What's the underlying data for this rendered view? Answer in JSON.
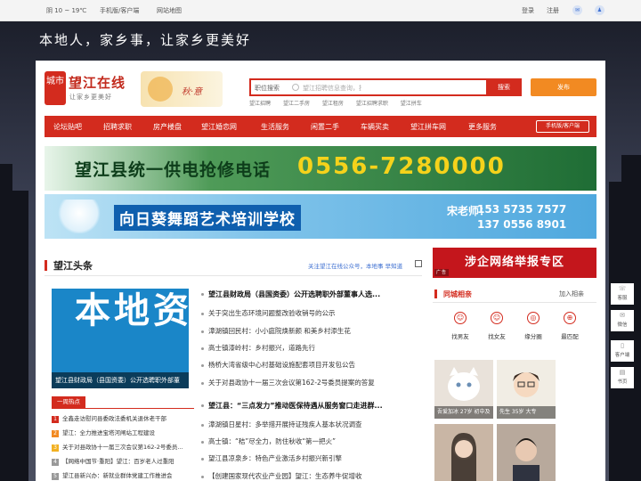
{
  "topbar": {
    "weather": "阴 10 ~ 19℃",
    "mobile": "手机版/客户端",
    "sitemap": "网站地图",
    "login": "登录",
    "register": "注册"
  },
  "slogan": "本地人，家乡事，让家乡更美好",
  "logo": {
    "seal": "城市",
    "name": "望江在线",
    "sub": "让家乡更美好"
  },
  "autumn_text": "秋·意",
  "search": {
    "category": "职位搜索",
    "placeholder": "望江招聘信息查询，找工作，就上望江在线",
    "button": "搜索"
  },
  "post_button": "发布",
  "hot_keywords": [
    "望江招聘",
    "望江二手房",
    "望江租房",
    "望江招聘求职",
    "望江拼车"
  ],
  "nav": {
    "items": [
      "论坛贴吧",
      "招聘求职",
      "房产楼盘",
      "望江婚恋网",
      "生活服务",
      "闲置二手",
      "车辆买卖",
      "望江拼车网",
      "更多服务"
    ],
    "mobile": "手机版/客户端"
  },
  "banner1": {
    "title": "望江县统一供电抢修电话",
    "phone": "0556-7280000"
  },
  "banner2": {
    "title": "向日葵舞蹈艺术培训学校",
    "contact": "宋老师：",
    "phone1": "153 5735 7577",
    "phone2": "137 0556 8901"
  },
  "section": {
    "title": "望江头条",
    "follow": "关注望江在线公众号，本地事 早知道"
  },
  "featured": {
    "big_text": "本地资讯",
    "caption": "望江县财政局（县国资委）公开选聘职外部董"
  },
  "hot_list": {
    "title": "一周热点",
    "items": [
      {
        "n": "1",
        "color": "#d32b1e",
        "text": "全鑫走访慰问县委政法委机关退休老干部"
      },
      {
        "n": "2",
        "color": "#f28a22",
        "text": "望江：全力推进宝塔河闸站工程建设"
      },
      {
        "n": "3",
        "color": "#f2b122",
        "text": "关于对县政协十一届三次会议第162-2号委员..."
      },
      {
        "n": "4",
        "color": "#999999",
        "text": "【网络中国节·重阳】望江：百岁老人过重阳"
      },
      {
        "n": "5",
        "color": "#999999",
        "text": "望江县新兴办：新就业群体党建工作推进会"
      }
    ]
  },
  "news": [
    {
      "text": "望江县财政局（县国资委）公开选聘职外部董事人选...",
      "bold": true
    },
    {
      "text": "关于突出生态环境问题整改验收销号的公示",
      "bold": false
    },
    {
      "text": "漳湖镇回民村：小小庭院焕新颜 和美乡村添生花",
      "bold": false
    },
    {
      "text": "高士镇漆岭村：乡村振兴，道路先行",
      "bold": false
    },
    {
      "text": "杨桥大湾省级中心村基础设施配套项目开发包公告",
      "bold": false
    },
    {
      "text": "关于对县政协十一届三次会议第162-2号委员提案的答复",
      "bold": false
    },
    {
      "text": "望江县：“三点发力”推动医保待遇从服务窗口走进群...",
      "bold": true
    },
    {
      "text": "漳湖镇日星村：多举措开展持证残疾人基本状况调查",
      "bold": false
    },
    {
      "text": "高士镇：“秸”尽全力，防住秋收“第一把火”",
      "bold": false
    },
    {
      "text": "望江县凉泉乡：特色产业激活乡村振兴新引擎",
      "bold": false
    },
    {
      "text": "【创建国家现代农业产业园】望江：生态养牛促增收",
      "bold": false
    }
  ],
  "ad_right": {
    "text": "涉企网络举报专区",
    "tag": "广告"
  },
  "friends": {
    "title": "同城相亲",
    "add": "加入相亲",
    "items": [
      {
        "icon": "person-icon",
        "glyph": "☺",
        "label": "找男友"
      },
      {
        "icon": "person-icon",
        "glyph": "☺",
        "label": "找女友"
      },
      {
        "icon": "target-icon",
        "glyph": "◎",
        "label": "缘分圈"
      },
      {
        "icon": "target-icon",
        "glyph": "⊕",
        "label": "最匹配"
      }
    ],
    "photos": [
      {
        "caption": "吾爱加冰 27岁 初中及",
        "color": "#e9e2da"
      },
      {
        "caption": "先生 35岁 大专",
        "color": "#f1ede4"
      },
      {
        "caption": "",
        "color": "#c9b6a5"
      },
      {
        "caption": "",
        "color": "#b8a99c"
      }
    ]
  },
  "side_tools": [
    {
      "icon": "headset-icon",
      "glyph": "☏",
      "label": "客服"
    },
    {
      "icon": "wechat-icon",
      "glyph": "✉",
      "label": "微信"
    },
    {
      "icon": "app-icon",
      "glyph": "▯",
      "label": "客户端"
    },
    {
      "icon": "book-icon",
      "glyph": "▤",
      "label": "书页"
    }
  ]
}
